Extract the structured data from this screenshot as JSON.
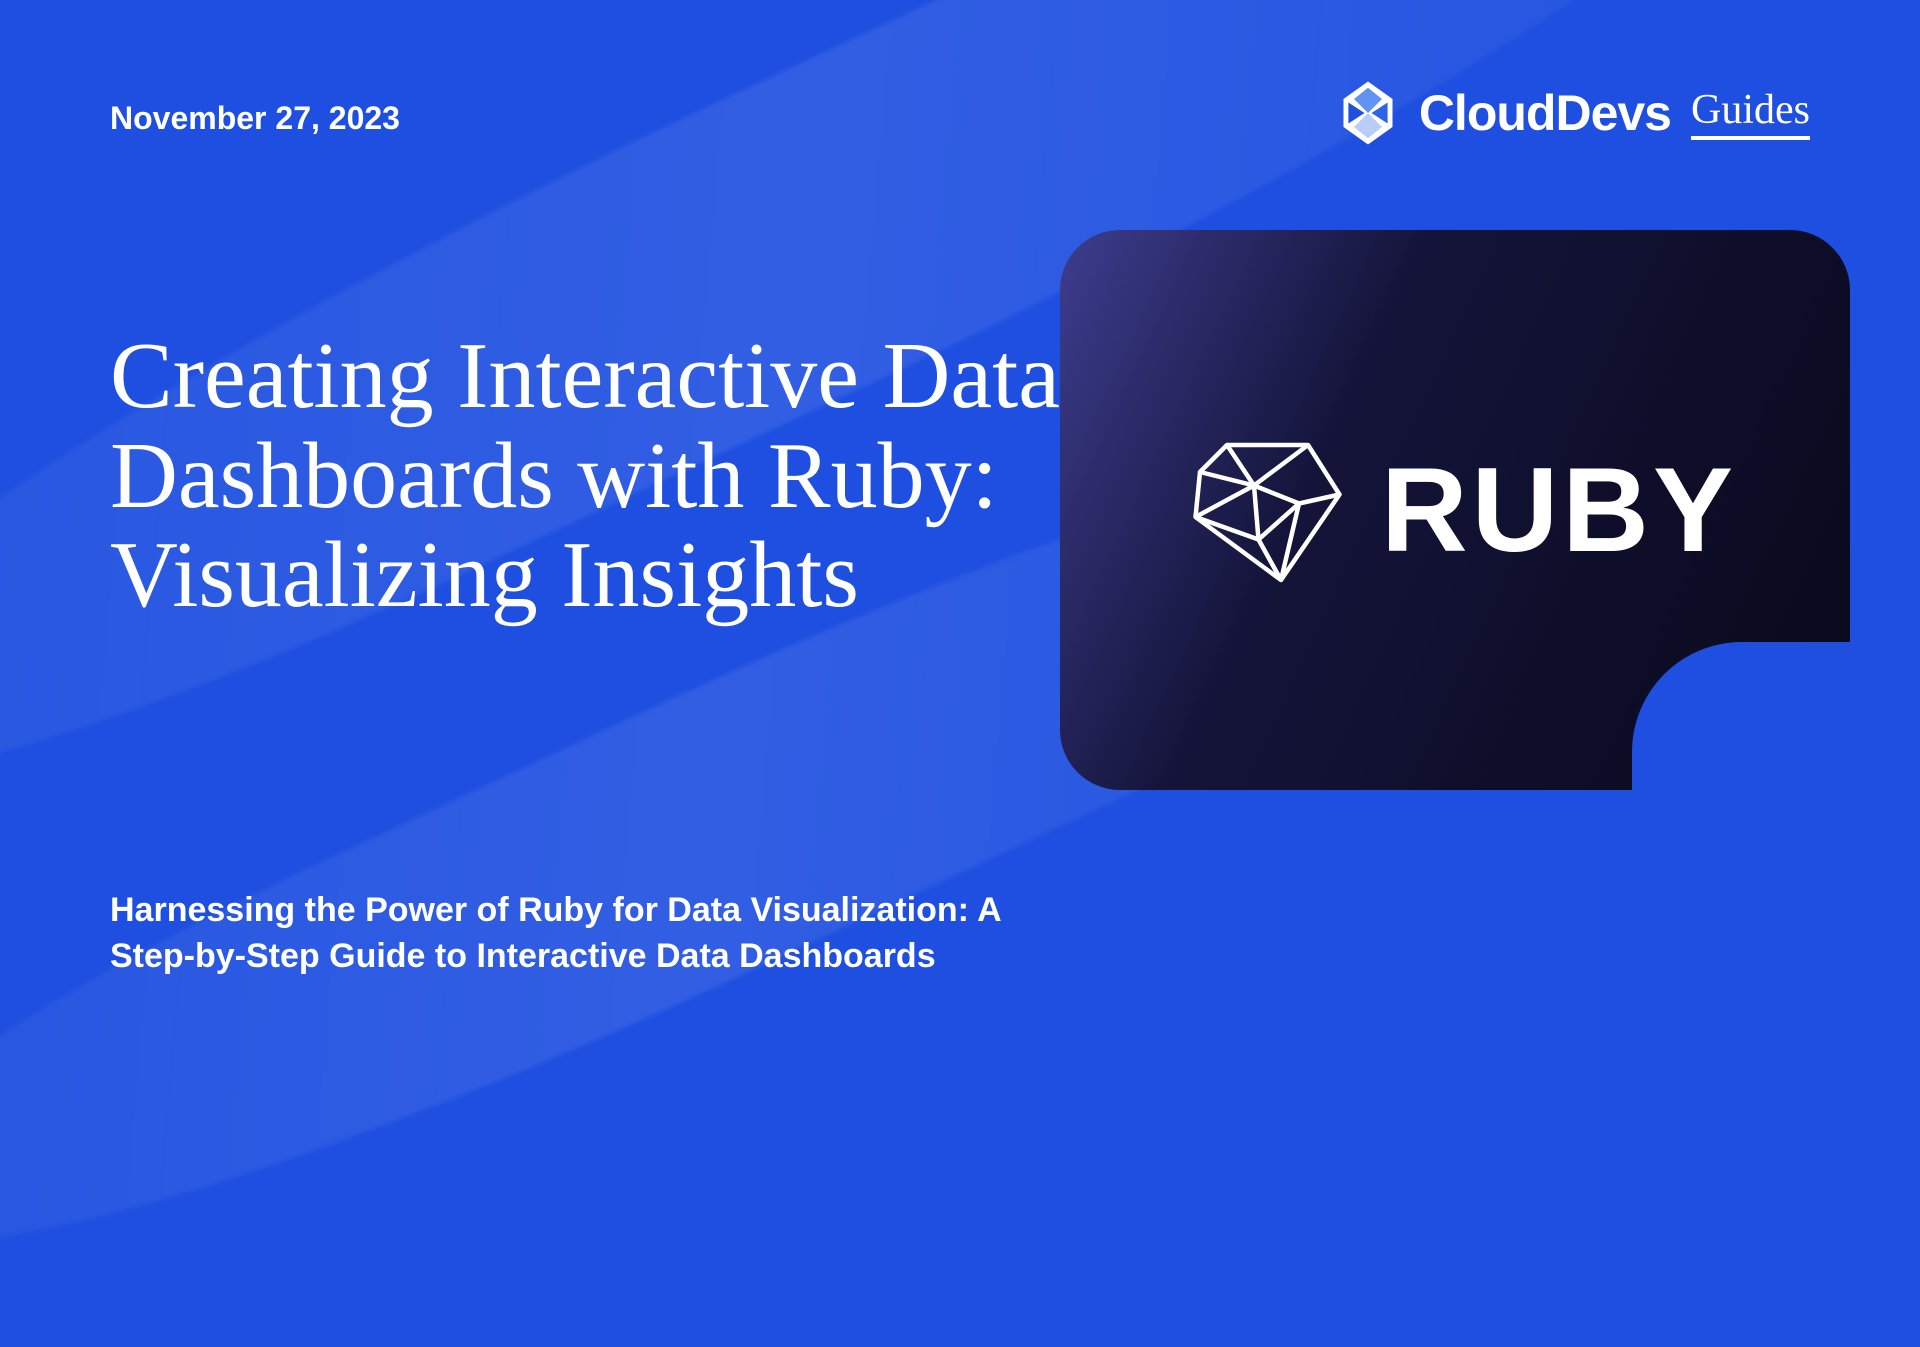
{
  "date": "November 27, 2023",
  "brand": {
    "name_main": "CloudDevs",
    "name_sub": "Guides"
  },
  "title": "Creating Interactive Data Dashboards with Ruby: Visualizing Insights",
  "subtitle": "Harnessing the Power of Ruby for Data Visualization: A Step-by-Step Guide to Interactive Data Dashboards",
  "hero": {
    "tech_label": "RUBY"
  }
}
